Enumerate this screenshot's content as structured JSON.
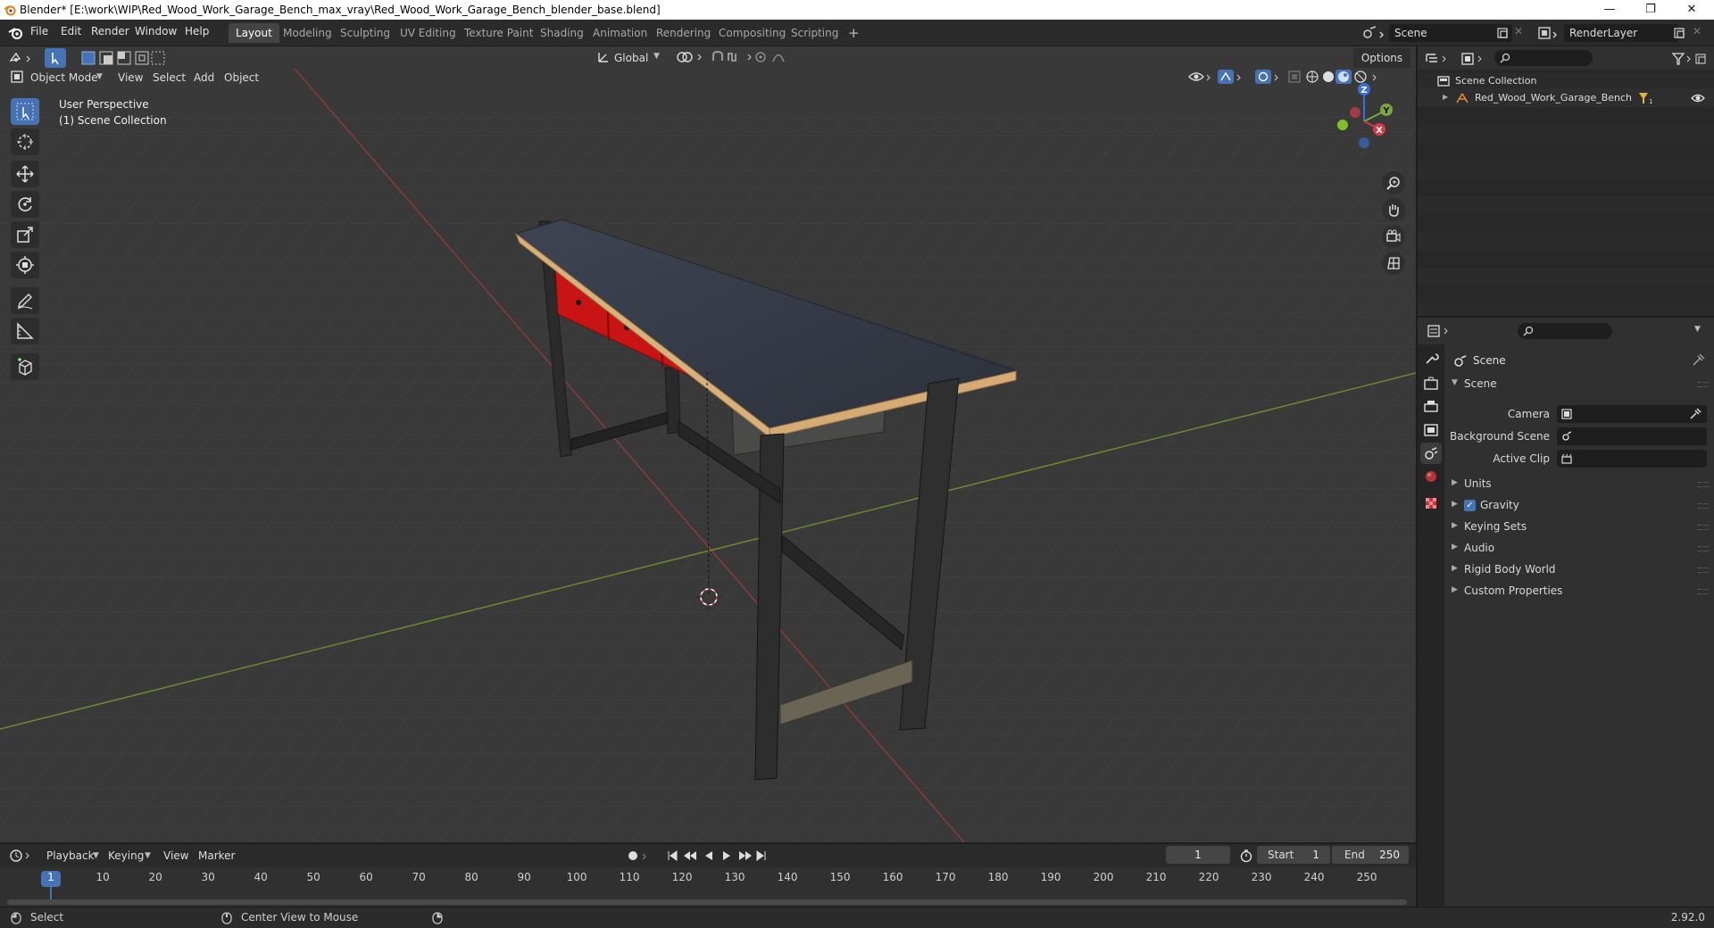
{
  "window": {
    "title": "Blender* [E:\\work\\WIP\\Red_Wood_Work_Garage_Bench_max_vray\\Red_Wood_Work_Garage_Bench_blender_base.blend]",
    "minimize": "—",
    "restore": "❐",
    "close": "✕"
  },
  "menu": [
    "File",
    "Edit",
    "Render",
    "Window",
    "Help"
  ],
  "workspaces": [
    "Layout",
    "Modeling",
    "Sculpting",
    "UV Editing",
    "Texture Paint",
    "Shading",
    "Animation",
    "Rendering",
    "Compositing",
    "Scripting"
  ],
  "workspace_add": "+",
  "scene_field": "Scene",
  "renderlayer_field": "RenderLayer",
  "viewport": {
    "mode": "Object Mode",
    "menus": [
      "View",
      "Select",
      "Add",
      "Object"
    ],
    "orientation": "Global",
    "options": "Options",
    "overlay_line1": "User Perspective",
    "overlay_line2": "(1) Scene Collection",
    "axis_labels": {
      "x": "X",
      "y": "Y",
      "z": "Z"
    }
  },
  "outliner": {
    "root": "Scene Collection",
    "object": "Red_Wood_Work_Garage_Bench"
  },
  "properties": {
    "context": "Scene",
    "panel": "Scene",
    "fields": [
      {
        "label": "Camera"
      },
      {
        "label": "Background Scene"
      },
      {
        "label": "Active Clip"
      }
    ],
    "subpanels": [
      "Units",
      "Gravity",
      "Keying Sets",
      "Audio",
      "Rigid Body World",
      "Custom Properties"
    ],
    "gravity_checked": true
  },
  "timeline": {
    "menus": [
      "Playback",
      "Keying",
      "View",
      "Marker"
    ],
    "current_frame": "1",
    "start_label": "Start",
    "start": "1",
    "end_label": "End",
    "end": "250",
    "ticks": [
      "1",
      "10",
      "20",
      "30",
      "40",
      "50",
      "60",
      "70",
      "80",
      "90",
      "100",
      "110",
      "120",
      "130",
      "140",
      "150",
      "160",
      "170",
      "180",
      "190",
      "200",
      "210",
      "220",
      "230",
      "240",
      "250"
    ]
  },
  "status": {
    "left": "Select",
    "middle": "Center View to Mouse",
    "version": "2.92.0"
  }
}
